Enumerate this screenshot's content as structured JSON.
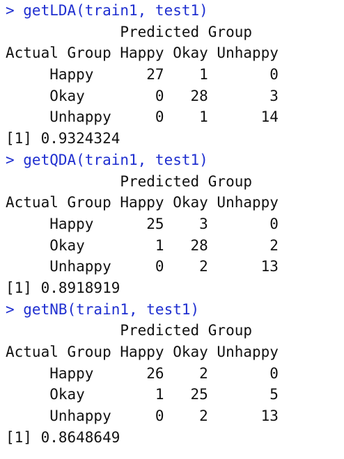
{
  "console": {
    "lines": [
      {
        "kind": "command",
        "text": "> getLDA(train1, test1)"
      },
      {
        "kind": "output",
        "text": "             Predicted Group"
      },
      {
        "kind": "output",
        "text": "Actual Group Happy Okay Unhappy"
      },
      {
        "kind": "output",
        "text": "     Happy      27    1       0"
      },
      {
        "kind": "output",
        "text": "     Okay        0   28       3"
      },
      {
        "kind": "output",
        "text": "     Unhappy     0    1      14"
      },
      {
        "kind": "output",
        "text": "[1] 0.9324324"
      },
      {
        "kind": "command",
        "text": "> getQDA(train1, test1)"
      },
      {
        "kind": "output",
        "text": "             Predicted Group"
      },
      {
        "kind": "output",
        "text": "Actual Group Happy Okay Unhappy"
      },
      {
        "kind": "output",
        "text": "     Happy      25    3       0"
      },
      {
        "kind": "output",
        "text": "     Okay        1   28       2"
      },
      {
        "kind": "output",
        "text": "     Unhappy     0    2      13"
      },
      {
        "kind": "output",
        "text": "[1] 0.8918919"
      },
      {
        "kind": "command",
        "text": "> getNB(train1, test1)"
      },
      {
        "kind": "output",
        "text": "             Predicted Group"
      },
      {
        "kind": "output",
        "text": "Actual Group Happy Okay Unhappy"
      },
      {
        "kind": "output",
        "text": "     Happy      26    2       0"
      },
      {
        "kind": "output",
        "text": "     Okay        1   25       5"
      },
      {
        "kind": "output",
        "text": "     Unhappy     0    2      13"
      },
      {
        "kind": "output",
        "text": "[1] 0.8648649"
      }
    ]
  },
  "colors": {
    "command": "#1f2fd0",
    "output": "#111111",
    "background": "#ffffff"
  }
}
